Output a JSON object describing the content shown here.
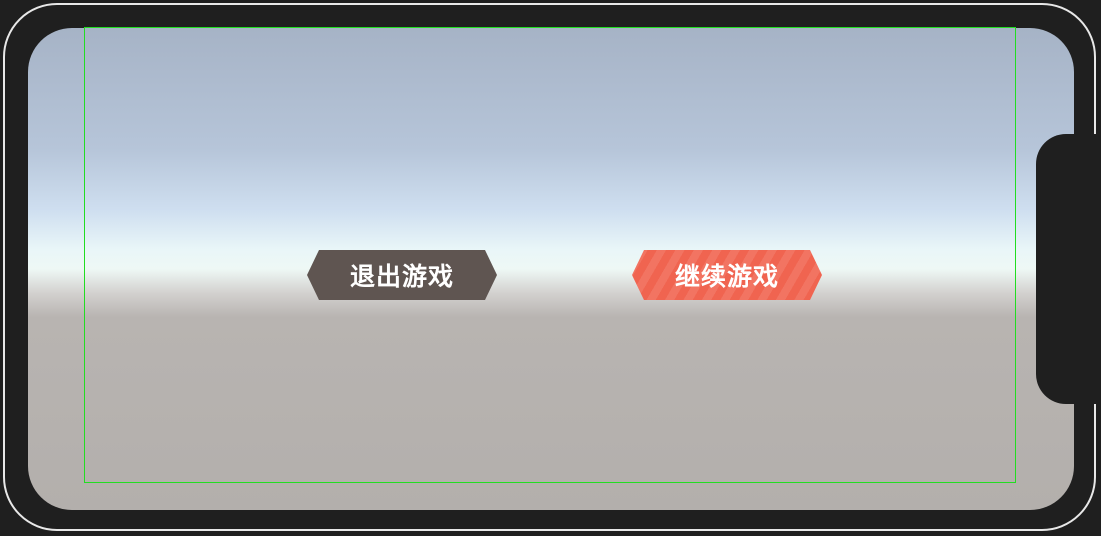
{
  "buttons": {
    "exit_label": "退出游戏",
    "continue_label": "继续游戏"
  },
  "colors": {
    "exit_button": "#5f5551",
    "continue_button": "#f06450",
    "safe_area_outline": "#22dd22",
    "device_bezel": "#1f1f1f"
  }
}
